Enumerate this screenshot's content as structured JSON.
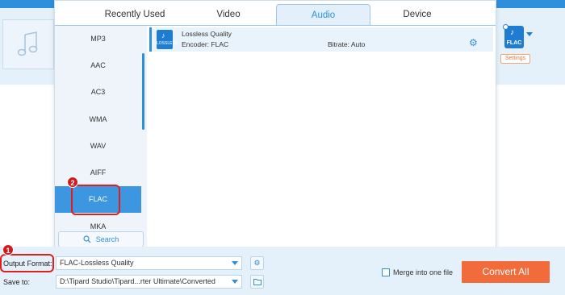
{
  "tabs": {
    "recent": "Recently Used",
    "video": "Video",
    "audio": "Audio",
    "device": "Device"
  },
  "formats": [
    "MP3",
    "AAC",
    "AC3",
    "WMA",
    "WAV",
    "AIFF",
    "FLAC",
    "MKA"
  ],
  "selected_format": "FLAC",
  "search": {
    "label": "Search",
    "icon": "search-icon"
  },
  "preset": {
    "title": "Lossless Quality",
    "encoder": "Encoder: FLAC",
    "bitrate": "Bitrate: Auto",
    "icon_label": "LOSSLESS"
  },
  "right_panel": {
    "badge": "FLAC",
    "settings": "Settings"
  },
  "bottom": {
    "output_format_label": "Output Format:",
    "output_format_value": "FLAC-Lossless Quality",
    "save_to_label": "Save to:",
    "save_to_value": "D:\\Tipard Studio\\Tipard...rter Ultimate\\Converted",
    "merge_label": "Merge into one file",
    "convert_label": "Convert All"
  },
  "annotations": [
    "1",
    "2"
  ],
  "colors": {
    "accent": "#2f8fdc",
    "selected": "#3d96e0",
    "convert": "#f26b3a",
    "annotation": "#e01e1e"
  }
}
